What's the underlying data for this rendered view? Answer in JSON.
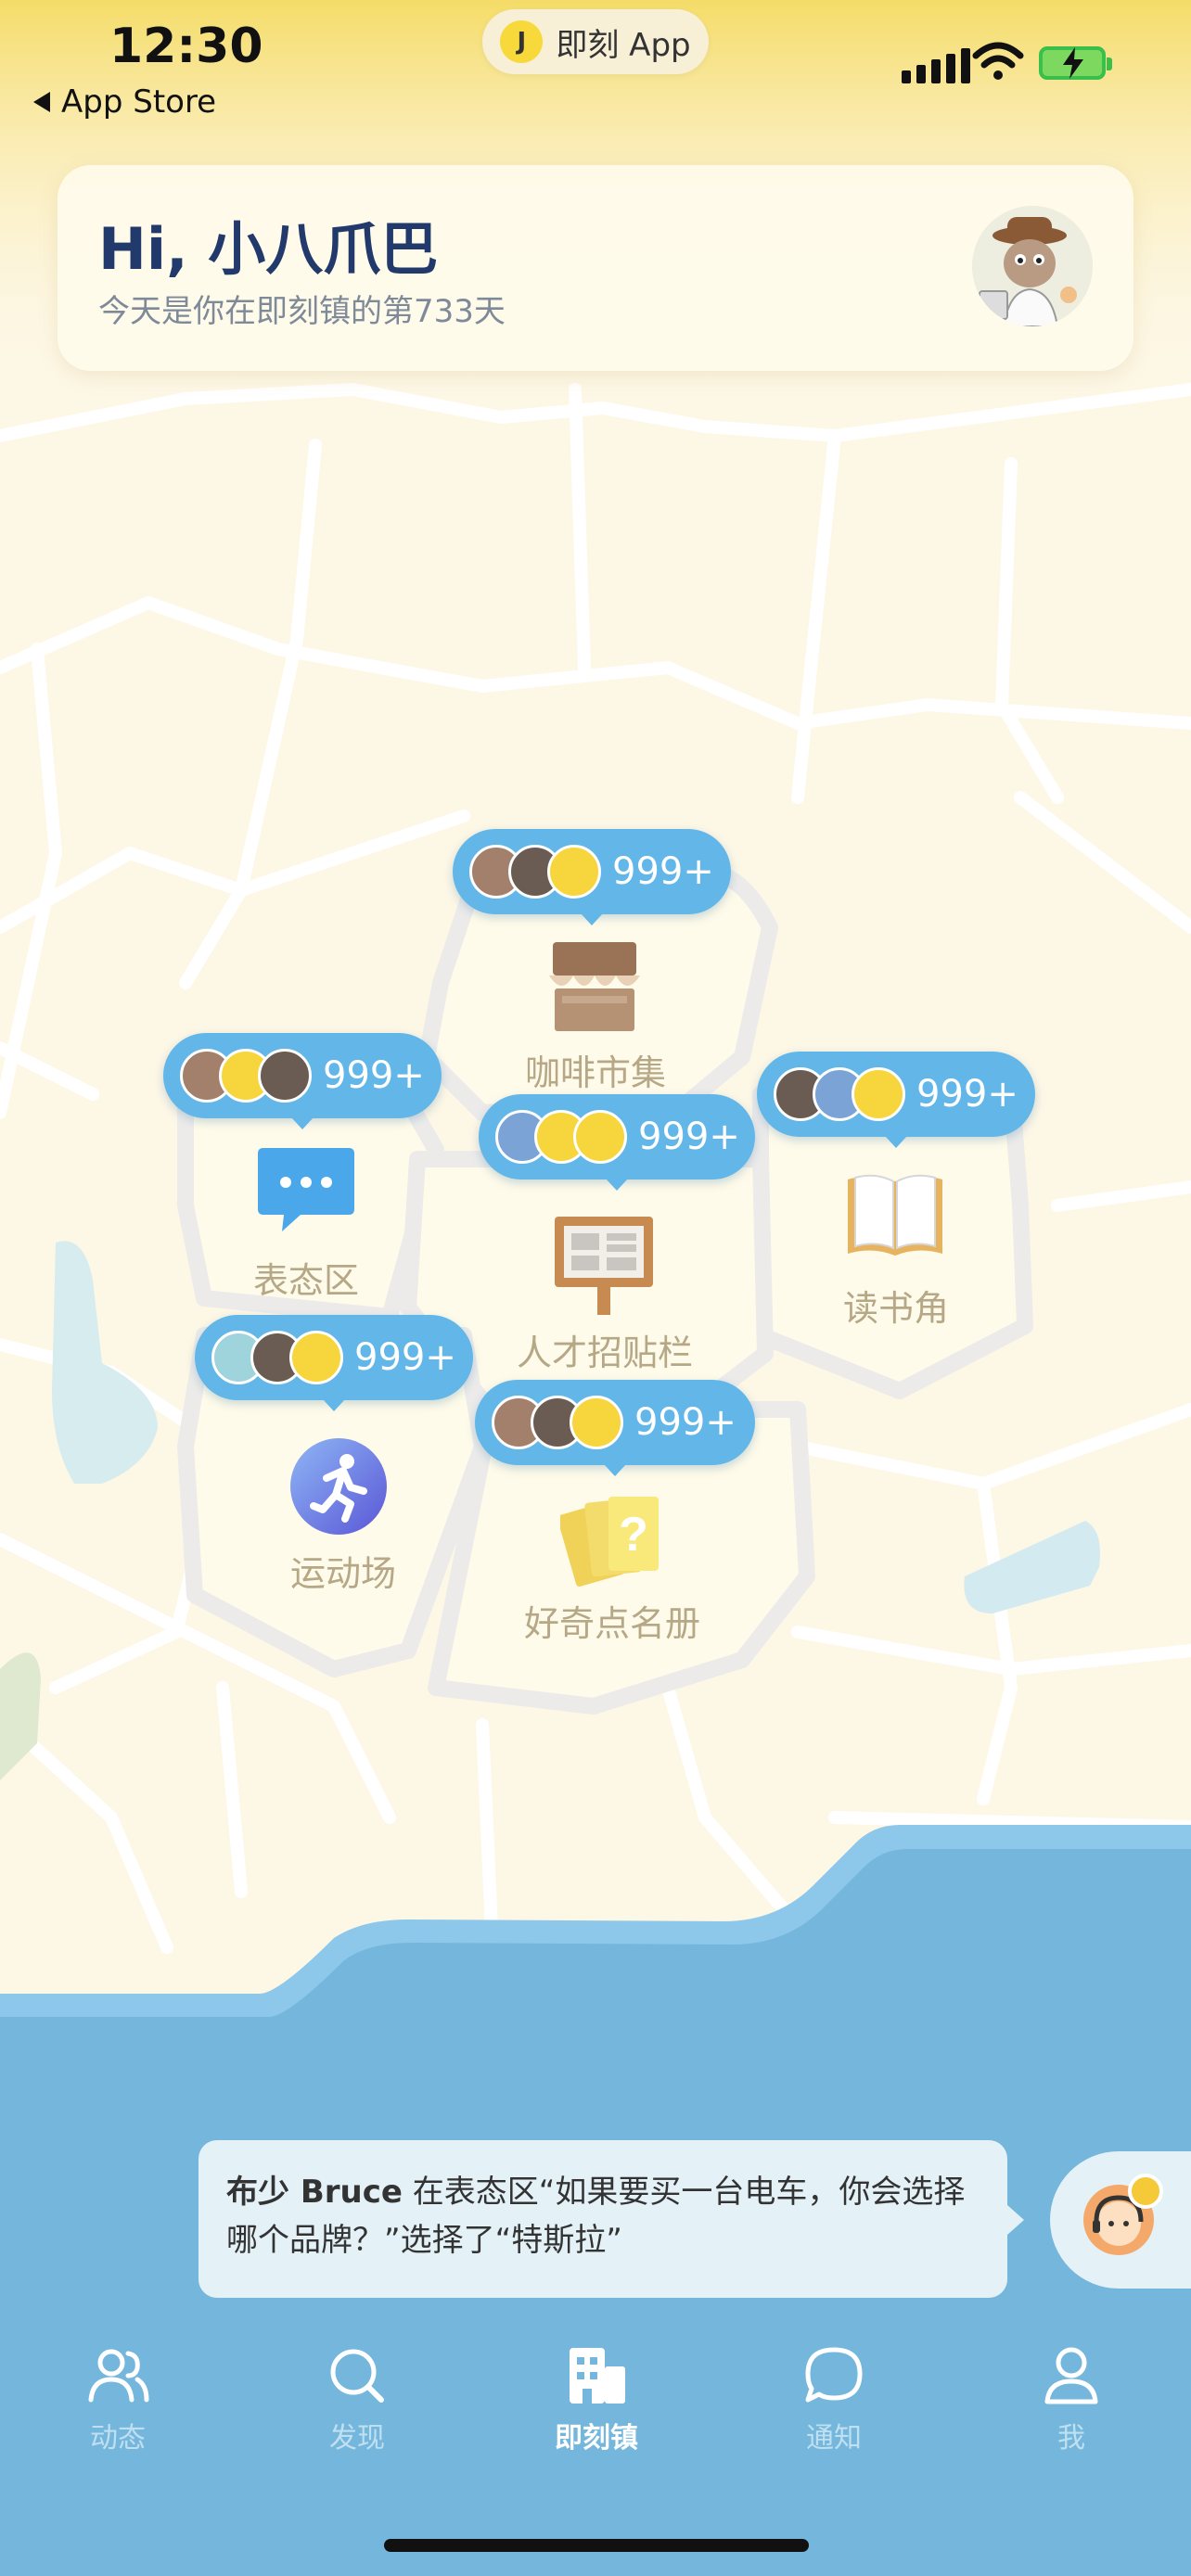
{
  "status_bar": {
    "time": "12:30",
    "back_label": "App Store",
    "app_pill": "即刻 App",
    "app_pill_logo": "J"
  },
  "greeting": {
    "title": "Hi, 小八爪巴",
    "subtitle": "今天是你在即刻镇的第733天"
  },
  "places": [
    {
      "id": "coffee",
      "label": "咖啡市集",
      "count": "999+",
      "icon": "market-stall-icon"
    },
    {
      "id": "opinion",
      "label": "表态区",
      "count": "999+",
      "icon": "chat-bubble-icon"
    },
    {
      "id": "jobs",
      "label": "人才招贴栏",
      "count": "999+",
      "icon": "bulletin-board-icon"
    },
    {
      "id": "reading",
      "label": "读书角",
      "count": "999+",
      "icon": "book-icon"
    },
    {
      "id": "sports",
      "label": "运动场",
      "count": "999+",
      "icon": "running-icon"
    },
    {
      "id": "curiosity",
      "label": "好奇点名册",
      "count": "999+",
      "icon": "question-cards-icon"
    }
  ],
  "notice": {
    "user": "布少 Bruce",
    "text": " 在表态区“如果要买一台电车，你会选择哪个品牌？”选择了“特斯拉”"
  },
  "tabs": [
    {
      "id": "feed",
      "label": "动态",
      "icon": "people-icon",
      "active": false
    },
    {
      "id": "discover",
      "label": "发现",
      "icon": "search-icon",
      "active": false
    },
    {
      "id": "town",
      "label": "即刻镇",
      "icon": "buildings-icon",
      "active": true
    },
    {
      "id": "notify",
      "label": "通知",
      "icon": "message-icon",
      "active": false
    },
    {
      "id": "me",
      "label": "我",
      "icon": "person-icon",
      "active": false
    }
  ],
  "colors": {
    "bubble": "#63b6e8",
    "sea": "#74b6dc",
    "land": "#fdf7e6",
    "header_gradient": "#f5dc68",
    "title": "#223a6b"
  }
}
